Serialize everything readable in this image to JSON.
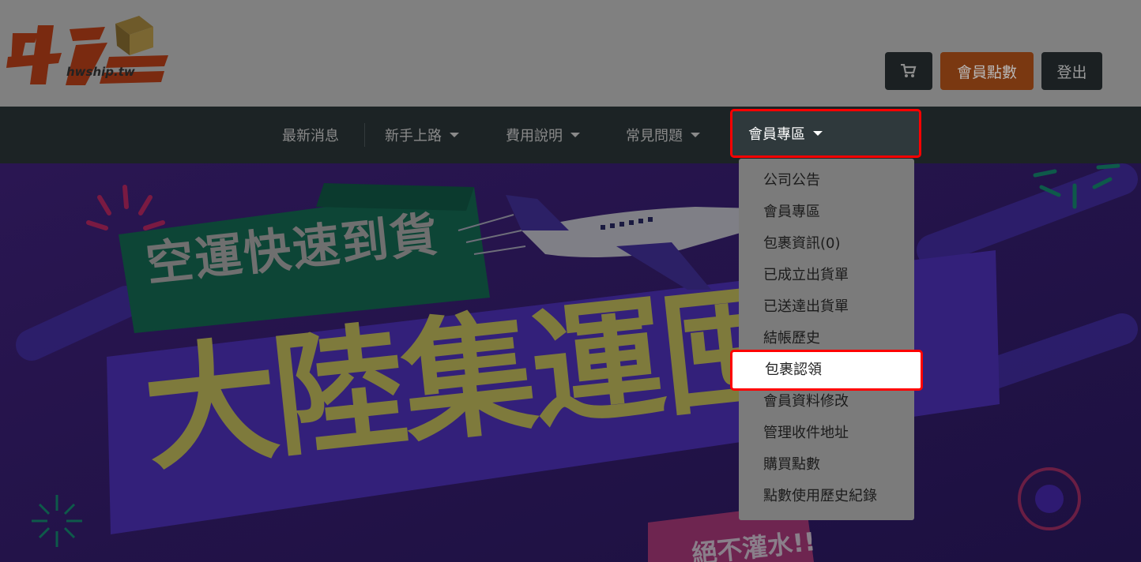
{
  "logo": {
    "tagline": "hwship.tw"
  },
  "header": {
    "cart_icon": "cart-icon",
    "points_label": "會員點數",
    "logout_label": "登出"
  },
  "nav": {
    "items": [
      {
        "label": "最新消息"
      },
      {
        "label": "新手上路"
      },
      {
        "label": "費用說明"
      },
      {
        "label": "常見問題"
      },
      {
        "label": "會員專區"
      }
    ]
  },
  "dropdown": {
    "items": [
      "公司公告",
      "會員專區",
      "包裹資訊(0)",
      "已成立出貨單",
      "已送達出貨單",
      "結帳歷史",
      "包裹認領",
      "會員資料修改",
      "管理收件地址",
      "購買點數",
      "點數使用歷史紀錄"
    ]
  },
  "banner": {
    "headline_small": "空運快速到貨",
    "headline_large": "大陸集運囤",
    "subline": "絕不灌水!!"
  },
  "colors": {
    "overlay": "#7f7f7f",
    "nav_bg": "#1c2325",
    "highlight_border": "#ff0000",
    "points_btn": "#7a3811"
  }
}
